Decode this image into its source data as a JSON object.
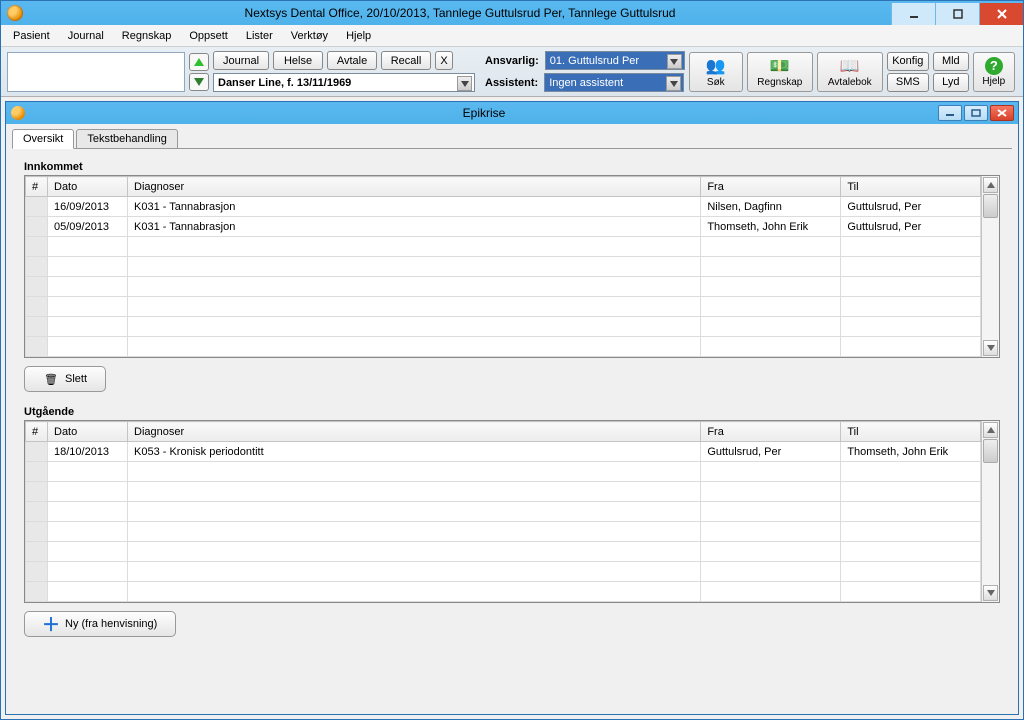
{
  "window": {
    "title": "Nextsys Dental Office,  20/10/2013, Tannlege Guttulsrud Per,  Tannlege Guttulsrud"
  },
  "menubar": [
    "Pasient",
    "Journal",
    "Regnskap",
    "Oppsett",
    "Lister",
    "Verktøy",
    "Hjelp"
  ],
  "toolbar": {
    "btn_journal": "Journal",
    "btn_helse": "Helse",
    "btn_avtale": "Avtale",
    "btn_recall": "Recall",
    "btn_x": "X",
    "patient_combo": "Danser Line, f. 13/11/1969",
    "lbl_ansvarlig": "Ansvarlig:",
    "ansvarlig_combo": "01. Guttulsrud Per",
    "lbl_assistent": "Assistent:",
    "assistent_combo": "Ingen assistent",
    "big_sok": "Søk",
    "big_regnskap": "Regnskap",
    "big_avtalebok": "Avtalebok",
    "btn_konfig": "Konfig",
    "btn_mld": "Mld",
    "btn_sms": "SMS",
    "btn_lyd": "Lyd",
    "big_hjelp": "Hjelp"
  },
  "subwindow": {
    "title": "Epikrise",
    "tabs": [
      "Oversikt",
      "Tekstbehandling"
    ],
    "active_tab": 0
  },
  "innkommet": {
    "title": "Innkommet",
    "cols": [
      "#",
      "Dato",
      "Diagnoser",
      "Fra",
      "Til"
    ],
    "rows": [
      {
        "num": "",
        "dato": "16/09/2013",
        "diag": "K031 - Tannabrasjon",
        "fra": "Nilsen, Dagfinn",
        "til": "Guttulsrud, Per"
      },
      {
        "num": "",
        "dato": "05/09/2013",
        "diag": "K031 - Tannabrasjon",
        "fra": "Thomseth, John Erik",
        "til": "Guttulsrud, Per"
      }
    ],
    "delete_btn": "Slett"
  },
  "utgaaende": {
    "title": "Utgående",
    "cols": [
      "#",
      "Dato",
      "Diagnoser",
      "Fra",
      "Til"
    ],
    "rows": [
      {
        "num": "",
        "dato": "18/10/2013",
        "diag": "K053 - Kronisk periodontitt",
        "fra": "Guttulsrud, Per",
        "til": "Thomseth, John Erik"
      }
    ],
    "new_btn": "Ny (fra henvisning)"
  }
}
